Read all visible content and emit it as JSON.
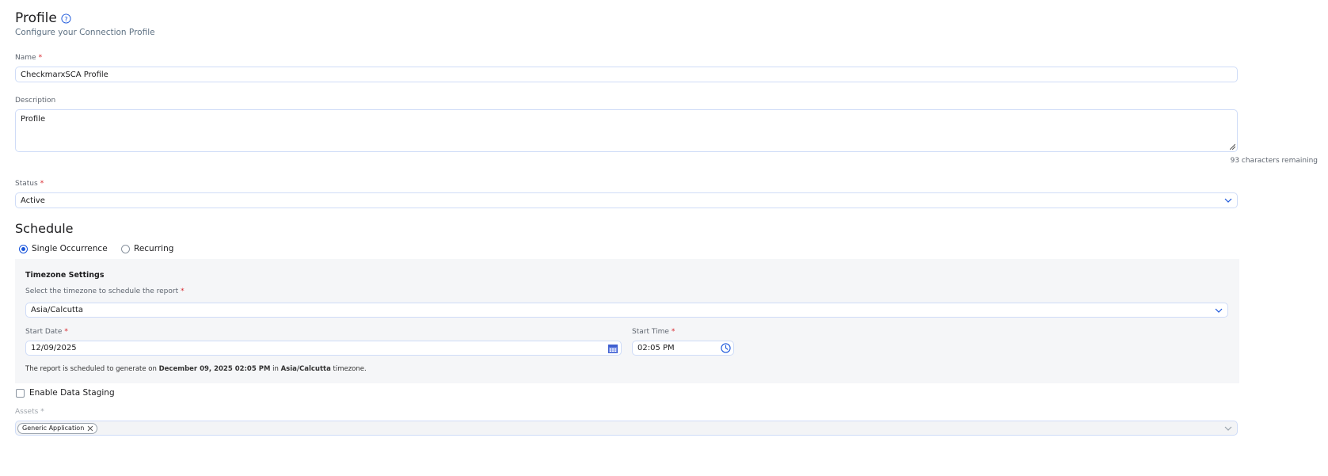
{
  "header": {
    "title": "Profile",
    "subtitle": "Configure your Connection Profile"
  },
  "name": {
    "label": "Name",
    "required": "*",
    "value": "CheckmarxSCA Profile"
  },
  "description": {
    "label": "Description",
    "value": "Profile",
    "counter": "93 characters remaining"
  },
  "status": {
    "label": "Status",
    "required": "*",
    "value": "Active"
  },
  "schedule": {
    "title": "Schedule",
    "options": [
      {
        "label": "Single Occurrence",
        "selected": true
      },
      {
        "label": "Recurring",
        "selected": false
      }
    ],
    "timezone_settings": {
      "title": "Timezone Settings",
      "tz_label": "Select the timezone to schedule the report",
      "required": "*",
      "tz_value": "Asia/Calcutta",
      "start_date_label": "Start Date",
      "start_date": "12/09/2025",
      "start_time_label": "Start Time",
      "start_time": "02:05 PM",
      "note_pre": "The report is scheduled to generate on ",
      "note_date": "December 09, 2025 02:05 PM",
      "note_mid": " in ",
      "note_tz": "Asia/Calcutta",
      "note_post": " timezone."
    }
  },
  "staging": {
    "label": "Enable Data Staging",
    "checked": false
  },
  "assets": {
    "label": "Assets",
    "required": "*",
    "chips": [
      "Generic Application"
    ]
  },
  "colors": {
    "accent": "#1a56db",
    "border": "#cfdcf7",
    "panel": "#f5f6f8",
    "required": "#d9262b"
  }
}
